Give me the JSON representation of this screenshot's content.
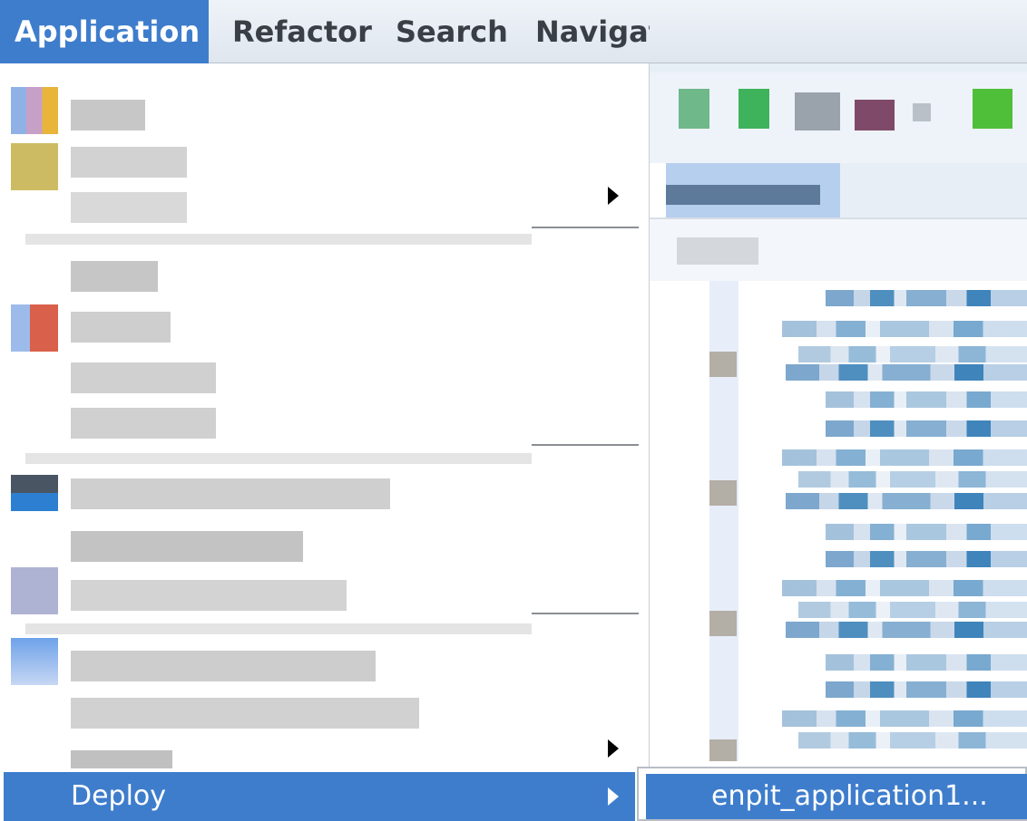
{
  "menubar": {
    "items": [
      {
        "label": "Application",
        "active": true
      },
      {
        "label": "Refactor",
        "active": false
      },
      {
        "label": "Search",
        "active": false
      },
      {
        "label": "Navigat",
        "active": false
      }
    ]
  },
  "dropdown": {
    "highlighted_item": {
      "label": "Deploy",
      "has_submenu": true
    },
    "blurred_note": "Other menu item labels are pixelated and unreadable"
  },
  "submenu": {
    "items": [
      {
        "label": "enpit_application1..."
      }
    ]
  },
  "colors": {
    "accent": "#3e7dcc",
    "menubar_bg": "#e4ebf2",
    "menu_text": "#3a3f46",
    "separator": "#8b8f94"
  }
}
